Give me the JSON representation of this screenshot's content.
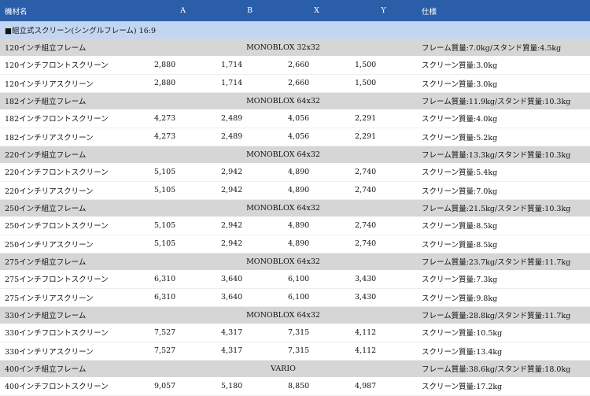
{
  "header": {
    "name": "機材名",
    "a": "A",
    "b": "B",
    "x": "X",
    "y": "Y",
    "spec": "仕様"
  },
  "section_title": "■組立式スクリーン(シングルフレーム) 16:9",
  "rows": [
    {
      "kind": "frame",
      "name": "120インチ組立フレーム",
      "model": "MONOBLOX 32x32",
      "spec": "フレーム質量:7.0kg/スタンド質量:4.5kg"
    },
    {
      "kind": "row",
      "name": "120インチフロントスクリーン",
      "a": "2,880",
      "b": "1,714",
      "x": "2,660",
      "y": "1,500",
      "spec": "スクリーン質量:3.0kg"
    },
    {
      "kind": "row",
      "name": "120インチリアスクリーン",
      "a": "2,880",
      "b": "1,714",
      "x": "2,660",
      "y": "1,500",
      "spec": "スクリーン質量:3.0kg"
    },
    {
      "kind": "frame",
      "name": "182インチ組立フレーム",
      "model": "MONOBLOX 64x32",
      "spec": "フレーム質量:11.9kg/スタンド質量:10.3kg"
    },
    {
      "kind": "row",
      "name": "182インチフロントスクリーン",
      "a": "4,273",
      "b": "2,489",
      "x": "4,056",
      "y": "2,291",
      "spec": "スクリーン質量:4.0kg"
    },
    {
      "kind": "row",
      "name": "182インチリアスクリーン",
      "a": "4,273",
      "b": "2,489",
      "x": "4,056",
      "y": "2,291",
      "spec": "スクリーン質量:5.2kg"
    },
    {
      "kind": "frame",
      "name": "220インチ組立フレーム",
      "model": "MONOBLOX 64x32",
      "spec": "フレーム質量:13.3kg/スタンド質量:10.3kg"
    },
    {
      "kind": "row",
      "name": "220インチフロントスクリーン",
      "a": "5,105",
      "b": "2,942",
      "x": "4,890",
      "y": "2,740",
      "spec": "スクリーン質量:5.4kg"
    },
    {
      "kind": "row",
      "name": "220インチリアスクリーン",
      "a": "5,105",
      "b": "2,942",
      "x": "4,890",
      "y": "2,740",
      "spec": "スクリーン質量:7.0kg"
    },
    {
      "kind": "frame",
      "name": "250インチ組立フレーム",
      "model": "MONOBLOX 64x32",
      "spec": "フレーム質量:21.5kg/スタンド質量:10.3kg"
    },
    {
      "kind": "row",
      "name": "250インチフロントスクリーン",
      "a": "5,105",
      "b": "2,942",
      "x": "4,890",
      "y": "2,740",
      "spec": "スクリーン質量:8.5kg"
    },
    {
      "kind": "row",
      "name": "250インチリアスクリーン",
      "a": "5,105",
      "b": "2,942",
      "x": "4,890",
      "y": "2,740",
      "spec": "スクリーン質量:8.5kg"
    },
    {
      "kind": "frame",
      "name": "275インチ組立フレーム",
      "model": "MONOBLOX 64x32",
      "spec": "フレーム質量:23.7kg/スタンド質量:11.7kg"
    },
    {
      "kind": "row",
      "name": "275インチフロントスクリーン",
      "a": "6,310",
      "b": "3,640",
      "x": "6,100",
      "y": "3,430",
      "spec": "スクリーン質量:7.3kg"
    },
    {
      "kind": "row",
      "name": "275インチリアスクリーン",
      "a": "6,310",
      "b": "3,640",
      "x": "6,100",
      "y": "3,430",
      "spec": "スクリーン質量:9.8kg"
    },
    {
      "kind": "frame",
      "name": "330インチ組立フレーム",
      "model": "MONOBLOX 64x32",
      "spec": "フレーム質量:28.8kg/スタンド質量:11.7kg"
    },
    {
      "kind": "row",
      "name": "330インチフロントスクリーン",
      "a": "7,527",
      "b": "4,317",
      "x": "7,315",
      "y": "4,112",
      "spec": "スクリーン質量:10.5kg"
    },
    {
      "kind": "row",
      "name": "330インチリアスクリーン",
      "a": "7,527",
      "b": "4,317",
      "x": "7,315",
      "y": "4,112",
      "spec": "スクリーン質量:13.4kg"
    },
    {
      "kind": "frame",
      "name": "400インチ組立フレーム",
      "model": "VARIO",
      "spec": "フレーム質量:38.6kg/スタンド質量:18.0kg"
    },
    {
      "kind": "row",
      "name": "400インチフロントスクリーン",
      "a": "9,057",
      "b": "5,180",
      "x": "8,850",
      "y": "4,987",
      "spec": "スクリーン質量:17.2kg"
    }
  ]
}
